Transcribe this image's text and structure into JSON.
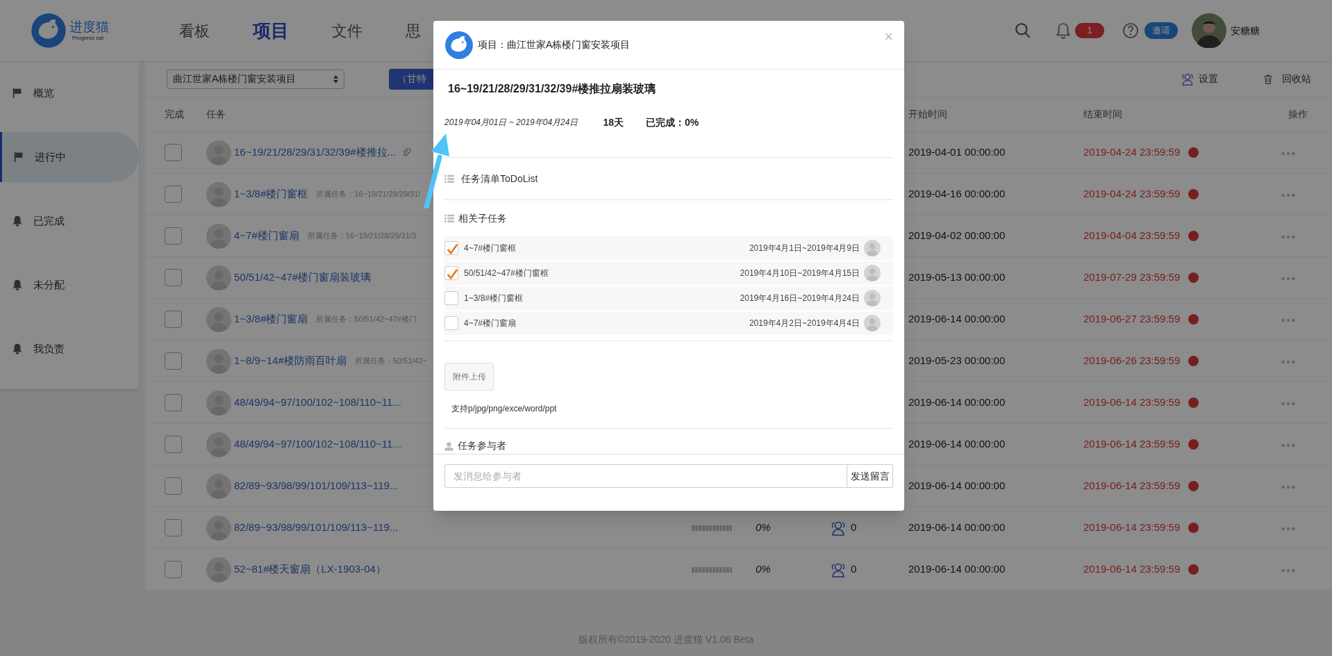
{
  "header": {
    "logo": {
      "name": "进度猫",
      "tagline": "Progress cat"
    },
    "nav": [
      {
        "label": "看板",
        "selected": false
      },
      {
        "label": "项目",
        "selected": true
      },
      {
        "label": "文件",
        "selected": false
      },
      {
        "label": "思",
        "selected": false
      }
    ],
    "notifications": "1",
    "invite": "邀请",
    "user": "安糖糖"
  },
  "sidebar": {
    "items": [
      {
        "label": "概览",
        "kind": "flag",
        "selected": false
      },
      {
        "label": "进行中",
        "kind": "flag",
        "selected": true
      },
      {
        "label": "已完成",
        "kind": "bell",
        "selected": false
      },
      {
        "label": "未分配",
        "kind": "bell",
        "selected": false
      },
      {
        "label": "我负责",
        "kind": "bell",
        "selected": false
      }
    ]
  },
  "toolbar": {
    "project_select": "曲江世家A栋楼门窗安装项目",
    "gantt_button": "（甘特",
    "settings": "设置",
    "recycle": "回收站"
  },
  "table": {
    "columns": [
      "完成",
      "任务",
      "开始时间",
      "结束时间",
      "操作"
    ],
    "rows": [
      {
        "checked": false,
        "title": "16~19/21/28/29/31/32/39#楼推拉...",
        "attachment": true,
        "start": "2019-04-01 00:00:00",
        "end": "2019-04-24 23:59:59",
        "overdue": true
      },
      {
        "checked": false,
        "title": "1~3/8#楼门窗框",
        "parent": "所属任务：16~19/21/28/29/31/",
        "attachment": false,
        "start": "2019-04-16 00:00:00",
        "end": "2019-04-24 23:59:59",
        "overdue": true
      },
      {
        "checked": false,
        "title": "4~7#楼门窗扇",
        "parent": "所属任务：16~19/21/28/29/31/3",
        "attachment": false,
        "start": "2019-04-02 00:00:00",
        "end": "2019-04-04 23:59:59",
        "overdue": true
      },
      {
        "checked": false,
        "title": "50/51/42~47#楼门窗扇装玻璃",
        "attachment": false,
        "start": "2019-05-13 00:00:00",
        "end": "2019-07-29 23:59:59",
        "overdue": true
      },
      {
        "checked": false,
        "title": "1~3/8#楼门窗扇",
        "parent": "所属任务：50/51/42~47#楼门",
        "attachment": false,
        "start": "2019-06-14 00:00:00",
        "end": "2019-06-27 23:59:59",
        "overdue": true
      },
      {
        "checked": false,
        "title": "1~8/9~14#楼防雨百叶扇",
        "parent": "所属任务：50/51/42~",
        "attachment": false,
        "start": "2019-05-23 00:00:00",
        "end": "2019-06-26 23:59:59",
        "overdue": true
      },
      {
        "checked": false,
        "title": "48/49/94~97/100/102~108/110~11...",
        "attachment": false,
        "start": "2019-06-14 00:00:00",
        "end": "2019-06-14 23:59:59",
        "overdue": true
      },
      {
        "checked": false,
        "title": "48/49/94~97/100/102~108/110~11...",
        "attachment": false,
        "start": "2019-06-14 00:00:00",
        "end": "2019-06-14 23:59:59",
        "overdue": true
      },
      {
        "checked": false,
        "title": "82/89~93/98/99/101/109/113~119...",
        "attachment": false,
        "start": "2019-06-14 00:00:00",
        "end": "2019-06-14 23:59:59",
        "overdue": true
      },
      {
        "checked": false,
        "title": "82/89~93/98/99/101/109/113~119...",
        "attachment": false,
        "level": 0,
        "percent": "0%",
        "members": "0",
        "start": "2019-06-14 00:00:00",
        "end": "2019-06-14 23:59:59",
        "overdue": true
      },
      {
        "checked": false,
        "title": "52~81#楼天窗扇（LX-1903-04）",
        "attachment": false,
        "level": 0,
        "percent": "0%",
        "members": "0",
        "start": "2019-06-14 00:00:00",
        "end": "2019-06-14 23:59:59",
        "overdue": true
      }
    ]
  },
  "footer": "版权所有©2019-2020 进度猫 V1.06 Beta",
  "modal": {
    "close": "×",
    "project": "项目：曲江世家A栋楼门窗安装项目",
    "title": "16~19/21/28/29/31/32/39#楼推拉扇装玻璃",
    "date_range": "2019年04月01日 ~ 2019年04月24日",
    "duration": "18天",
    "completed": "已完成：0%",
    "todo_heading": "任务清单ToDoList",
    "subtasks_heading": "相关子任务",
    "subtasks": [
      {
        "name": "4~7#楼门窗框",
        "dates": "2019年4月1日~2019年4月9日",
        "checked": true
      },
      {
        "name": "50/51/42~47#楼门窗框",
        "dates": "2019年4月10日~2019年4月15日",
        "checked": true
      },
      {
        "name": "1~3/8#楼门窗框",
        "dates": "2019年4月16日~2019年4月24日",
        "checked": false
      },
      {
        "name": "4~7#楼门窗扇",
        "dates": "2019年4月2日~2019年4月4日",
        "checked": false
      }
    ],
    "upload_button": "附件上传",
    "upload_hint": "支持p/jpg/png/exce/word/ppt",
    "participants_heading": "任务参与者",
    "message_placeholder": "发消息给参与者",
    "send_button": "发送留言"
  }
}
